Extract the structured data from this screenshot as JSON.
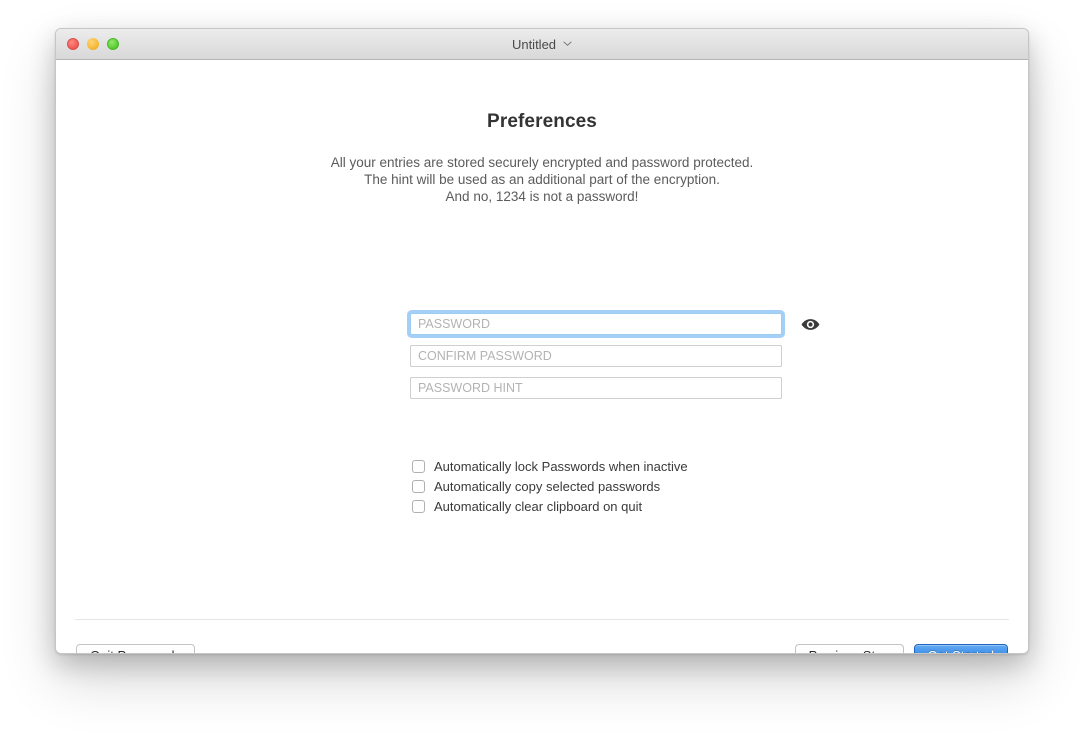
{
  "window": {
    "title": "Untitled",
    "title_chevron_icon": "chevron-down-icon",
    "traffic_lights": [
      {
        "name": "close",
        "color": "#f4625c"
      },
      {
        "name": "minimize",
        "color": "#f7bc3a"
      },
      {
        "name": "zoom",
        "color": "#63d13c"
      }
    ]
  },
  "page": {
    "title": "Preferences",
    "description_lines": [
      "All your entries are stored securely encrypted and password protected.",
      "The hint will be used as an additional part of the encryption.",
      "And no, 1234 is not a password!"
    ]
  },
  "form": {
    "password": {
      "placeholder": "PASSWORD",
      "value": "",
      "focused": true
    },
    "confirm_password": {
      "placeholder": "CONFIRM PASSWORD",
      "value": "",
      "focused": false
    },
    "password_hint": {
      "placeholder": "PASSWORD HINT",
      "value": "",
      "focused": false
    },
    "reveal_icon": "eye-icon",
    "focus_ring_color": "#5aaaf0"
  },
  "options": [
    {
      "label": "Automatically lock Passwords when inactive",
      "checked": false
    },
    {
      "label": "Automatically copy selected passwords",
      "checked": false
    },
    {
      "label": "Automatically clear clipboard on quit",
      "checked": false
    }
  ],
  "footer": {
    "quit_label": "Quit Passwords",
    "previous_label": "Previous Step",
    "get_started_label": "Get Started",
    "primary_color": "#2a7fe0"
  }
}
